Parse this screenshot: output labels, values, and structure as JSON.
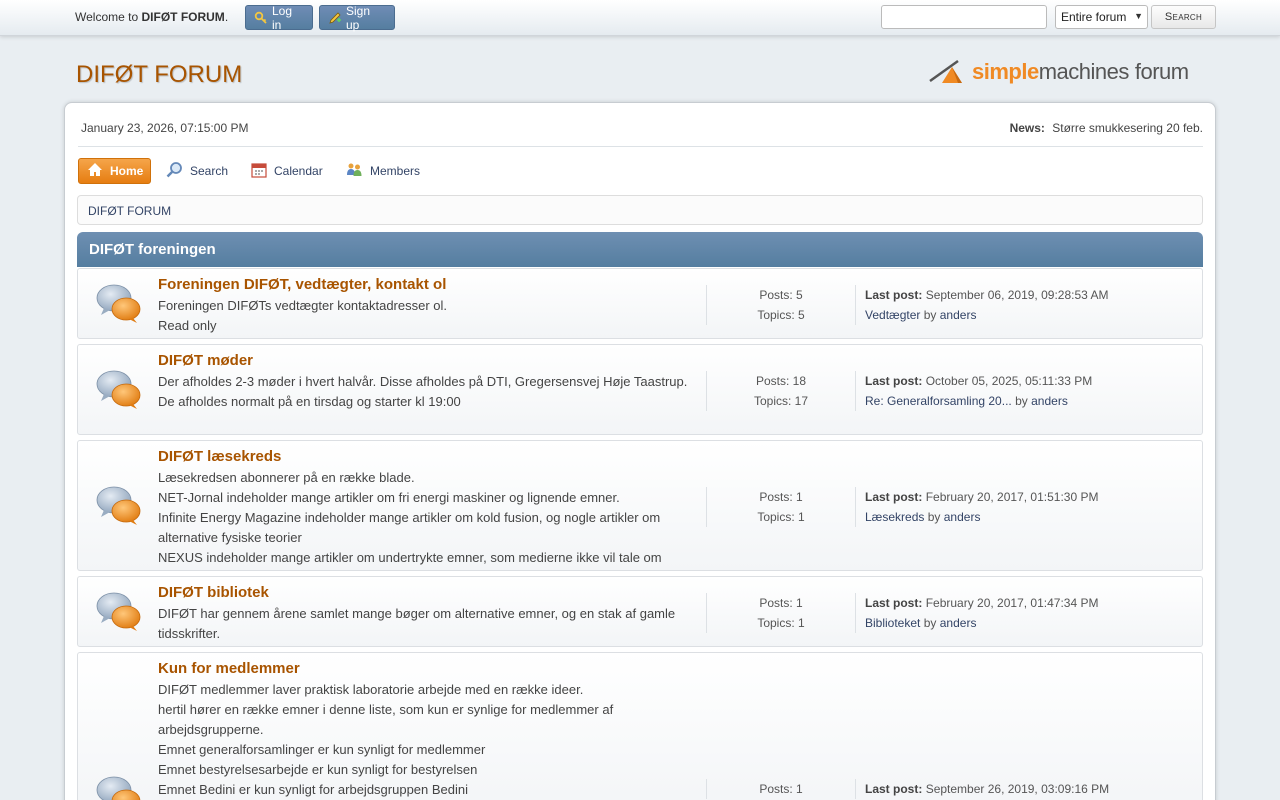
{
  "topbar": {
    "welcome_prefix": "Welcome to",
    "forum_name": "DIFØT FORUM",
    "welcome_suffix": ".",
    "login_label": "Log in",
    "signup_label": "Sign up",
    "search_placeholder": "",
    "search_scope": "Entire forum",
    "search_button": "Search"
  },
  "header": {
    "title": "DIFØT FORUM",
    "logo_text_a": "simple",
    "logo_text_b": "machines",
    "logo_text_c": "forum"
  },
  "info": {
    "date": "January 23, 2026, 07:15:00 PM",
    "news_label": "News:",
    "news_text": "Større smukkesering 20 feb."
  },
  "menu": {
    "home": "Home",
    "search": "Search",
    "calendar": "Calendar",
    "members": "Members"
  },
  "breadcrumb": "DIFØT FORUM",
  "category": "DIFØT foreningen",
  "boards": [
    {
      "title": "Foreningen DIFØT, vedtægter, kontakt ol",
      "desc": [
        "Foreningen DIFØTs vedtægter kontaktadresser ol.",
        "Read only"
      ],
      "posts": "Posts: 5",
      "topics": "Topics: 5",
      "last_label": "Last post:",
      "last_date": "September 06, 2019, 09:28:53 AM",
      "last_topic": "Vedtægter",
      "by": "by",
      "last_user": "anders"
    },
    {
      "title": "DIFØT møder",
      "desc": [
        "Der afholdes 2-3 møder i hvert halvår. Disse afholdes på DTI, Gregersensvej Høje Taastrup.",
        "De afholdes normalt på en tirsdag og starter kl 19:00"
      ],
      "posts": "Posts: 18",
      "topics": "Topics: 17",
      "last_label": "Last post:",
      "last_date": "October 05, 2025, 05:11:33 PM",
      "last_topic": "Re: Generalforsamling 20...",
      "by": "by",
      "last_user": "anders"
    },
    {
      "title": "DIFØT læsekreds",
      "desc": [
        "Læsekredsen abonnerer på en række blade.",
        "NET-Jornal indeholder mange artikler om fri energi maskiner og lignende emner.",
        "Infinite Energy Magazine indeholder mange artikler om kold fusion, og nogle artikler om alternative fysiske teorier",
        "NEXUS indeholder mange artikler om undertrykte emner, som medierne ikke vil tale om"
      ],
      "posts": "Posts: 1",
      "topics": "Topics: 1",
      "last_label": "Last post:",
      "last_date": "February 20, 2017, 01:51:30 PM",
      "last_topic": "Læsekreds",
      "by": "by",
      "last_user": "anders"
    },
    {
      "title": "DIFØT bibliotek",
      "desc": [
        "DIFØT har gennem årene samlet mange bøger om alternative emner, og en stak af gamle tidsskrifter."
      ],
      "posts": "Posts: 1",
      "topics": "Topics: 1",
      "last_label": "Last post:",
      "last_date": "February 20, 2017, 01:47:34 PM",
      "last_topic": "Biblioteket",
      "by": "by",
      "last_user": "anders"
    },
    {
      "title": "Kun for medlemmer",
      "desc": [
        "DIFØT medlemmer laver praktisk laboratorie arbejde med en række ideer.",
        "hertil hører en række emner i denne liste, som kun er synlige for medlemmer af arbejdsgrupperne.",
        "Emnet generalforsamlinger er kun synligt for medlemmer",
        "Emnet bestyrelsesarbejde er kun synligt for bestyrelsen",
        "Emnet Bedini er kun synligt for arbejdsgruppen Bedini"
      ],
      "posts": "Posts: 1",
      "last_label": "Last post:",
      "last_date": "September 26, 2019, 03:09:16 PM"
    }
  ],
  "colors": {
    "accent": "#a85400",
    "link": "#334466",
    "header_blue": "#557ea0",
    "home_orange": "#e67d11"
  }
}
